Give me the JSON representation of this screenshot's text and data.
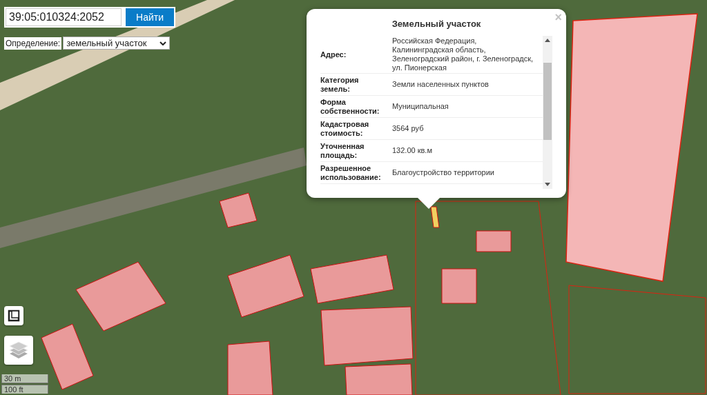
{
  "search": {
    "value": "39:05:010324:2052",
    "button": "Найти"
  },
  "definition": {
    "label": "Определение:",
    "value": "земельный участок"
  },
  "popup": {
    "title": "Земельный участок",
    "close": "×",
    "rows": [
      {
        "label": "Адрес:",
        "value": "Российская Федерация, Калининградская область, Зеленоградский район, г. Зеленоградск, ул. Пионерская"
      },
      {
        "label": "Категория земель:",
        "value": "Земли населенных пунктов"
      },
      {
        "label": "Форма собственности:",
        "value": "Муниципальная"
      },
      {
        "label": "Кадастровая стоимость:",
        "value": "3564 руб"
      },
      {
        "label": "Уточненная площадь:",
        "value": "132.00 кв.м"
      },
      {
        "label": "Разрешенное использование:",
        "value": "Благоустройство территории"
      }
    ]
  },
  "scale": [
    "30 m",
    "100 ft"
  ]
}
